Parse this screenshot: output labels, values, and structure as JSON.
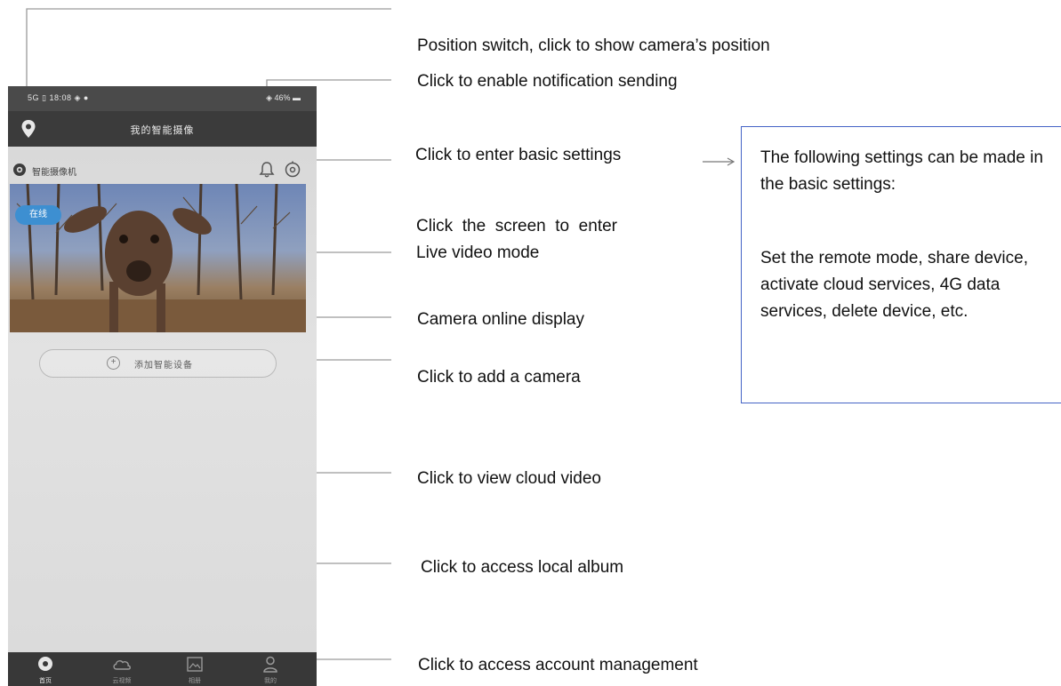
{
  "phone": {
    "status_bar": {
      "left": "5G ▯ 18:08 ◈ ●",
      "right": "◈ 46% ▬"
    },
    "header": {
      "title": "我的智能摄像",
      "location_icon": "location-pin-icon"
    },
    "device": {
      "name": "智能摄像机",
      "camera_icon": "camera-icon",
      "bell_icon": "bell-icon",
      "settings_icon": "settings-icon"
    },
    "preview": {
      "online_badge": "在线"
    },
    "add_button": {
      "label": "添加智能设备"
    },
    "tabs": [
      {
        "label": "首页",
        "icon": "home-icon"
      },
      {
        "label": "云视频",
        "icon": "cloud-icon"
      },
      {
        "label": "相册",
        "icon": "album-icon"
      },
      {
        "label": "我的",
        "icon": "person-icon"
      }
    ]
  },
  "annotations": {
    "position_switch": "Position switch, click to show camera’s position",
    "notification": "Click to enable notification sending",
    "basic_settings": "Click to enter basic settings",
    "live_line1": "Click  the  screen  to  enter",
    "live_line2": "Live video mode",
    "online_display": "Camera online display",
    "add_camera": "Click to add a camera",
    "cloud_video": "Click to view cloud video",
    "local_album": "Click to access local album",
    "account": "Click to access account management"
  },
  "infobox": {
    "title": "The following settings can be made in the basic settings:",
    "body": "Set the remote mode, share device, activate cloud services, 4G data services, delete device, etc."
  },
  "colors": {
    "infobox_border": "#4463c6",
    "online_badge": "#3d8fd1",
    "header_bg": "#3b3b3b",
    "tabbar_bg": "#383838"
  }
}
